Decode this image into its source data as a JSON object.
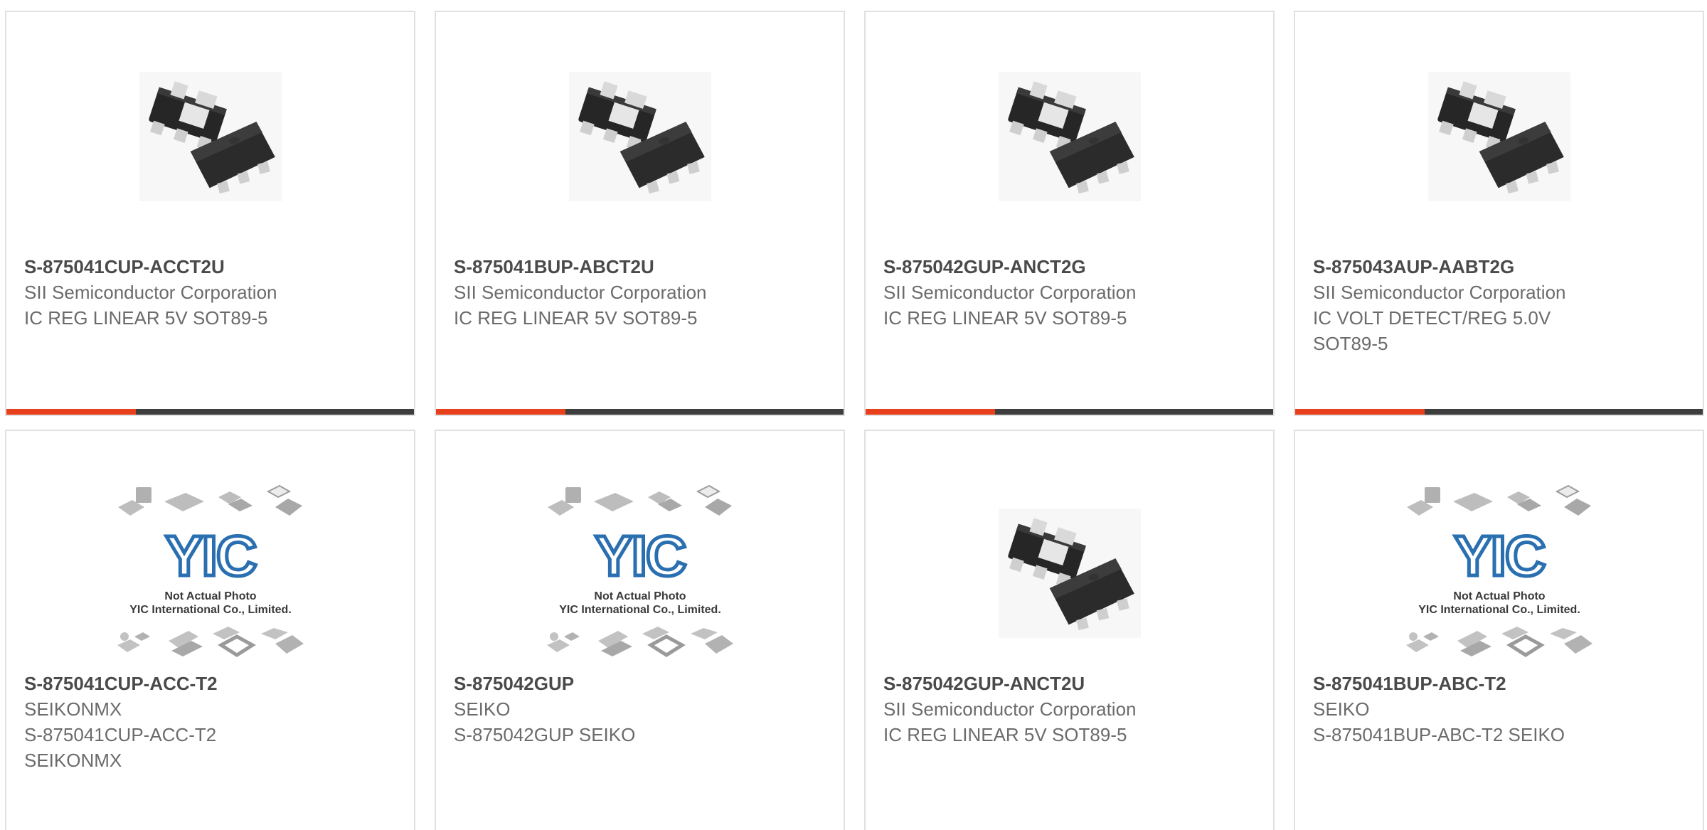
{
  "products": [
    {
      "part_number": "S-875041CUP-ACCT2U",
      "manufacturer": "SII Semiconductor Corporation",
      "description": "IC REG LINEAR 5V SOT89-5",
      "image": "sot89-package-photo"
    },
    {
      "part_number": "S-875041BUP-ABCT2U",
      "manufacturer": "SII Semiconductor Corporation",
      "description": "IC REG LINEAR 5V SOT89-5",
      "image": "sot89-package-photo"
    },
    {
      "part_number": "S-875042GUP-ANCT2G",
      "manufacturer": "SII Semiconductor Corporation",
      "description": "IC REG LINEAR 5V SOT89-5",
      "image": "sot89-package-photo"
    },
    {
      "part_number": "S-875043AUP-AABT2G",
      "manufacturer": "SII Semiconductor Corporation",
      "description": "IC VOLT DETECT/REG 5.0V SOT89-5",
      "image": "sot89-package-photo"
    },
    {
      "part_number": "S-875041CUP-ACC-T2",
      "manufacturer": "SEIKONMX",
      "description": "S-875041CUP-ACC-T2 SEIKONMX",
      "image": "placeholder-not-actual-photo",
      "placeholder_line1": "Not Actual Photo",
      "placeholder_line2": "YIC International Co., Limited.",
      "placeholder_logo": "YIC"
    },
    {
      "part_number": "S-875042GUP",
      "manufacturer": "SEIKO",
      "description": "S-875042GUP SEIKO",
      "image": "placeholder-not-actual-photo",
      "placeholder_line1": "Not Actual Photo",
      "placeholder_line2": "YIC International Co., Limited.",
      "placeholder_logo": "YIC"
    },
    {
      "part_number": "S-875042GUP-ANCT2U",
      "manufacturer": "SII Semiconductor Corporation",
      "description": "IC REG LINEAR 5V SOT89-5",
      "image": "sot89-package-photo"
    },
    {
      "part_number": "S-875041BUP-ABC-T2",
      "manufacturer": "SEIKO",
      "description": "S-875041BUP-ABC-T2 SEIKO",
      "image": "placeholder-not-actual-photo",
      "placeholder_line1": "Not Actual Photo",
      "placeholder_line2": "YIC International Co., Limited.",
      "placeholder_logo": "YIC"
    }
  ],
  "colors": {
    "accent": "#e8401c",
    "bar_dark": "#3d3d3d",
    "part_number_text": "#4a4a4a",
    "secondary_text": "#6b6b6b",
    "card_border": "#e1e1e1",
    "logo_blue": "#2a6fb0"
  }
}
